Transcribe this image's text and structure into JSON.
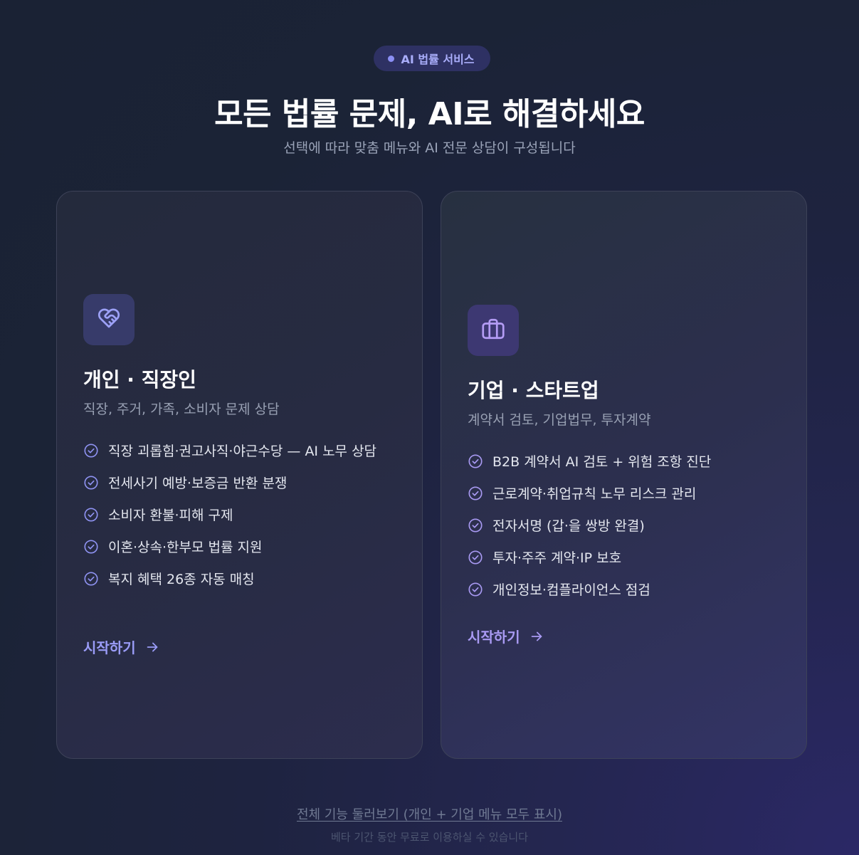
{
  "badge": {
    "label": "AI 법률 서비스"
  },
  "hero": {
    "title": "모든 법률 문제, AI로 해결하세요",
    "subtitle": "선택에 따라 맞춤 메뉴와 AI 전문 상담이 구성됩니다"
  },
  "cards": {
    "personal": {
      "icon": "handshake-heart-icon",
      "title": "개인 · 직장인",
      "description": "직장, 주거, 가족, 소비자 문제 상담",
      "features": [
        "직장 괴롭힘·권고사직·야근수당 — AI 노무 상담",
        "전세사기 예방·보증금 반환 분쟁",
        "소비자 환불·피해 구제",
        "이혼·상속·한부모 법률 지원",
        "복지 혜택 26종 자동 매칭"
      ],
      "cta": "시작하기"
    },
    "business": {
      "icon": "briefcase-icon",
      "title": "기업 · 스타트업",
      "description": "계약서 검토, 기업법무, 투자계약",
      "features": [
        "B2B 계약서 AI 검토 + 위험 조항 진단",
        "근로계약·취업규칙 노무 리스크 관리",
        "전자서명 (갑·을 쌍방 완결)",
        "투자·주주 계약·IP 보호",
        "개인정보·컴플라이언스 점검"
      ],
      "cta": "시작하기"
    }
  },
  "footer": {
    "link": "전체 기능 둘러보기 (개인 + 기업 메뉴 모두 표시)",
    "note": "베타 기간 동안 무료로 이용하실 수 있습니다"
  },
  "colors": {
    "accent": "#9a9cf7",
    "check": "#8f93f2"
  }
}
